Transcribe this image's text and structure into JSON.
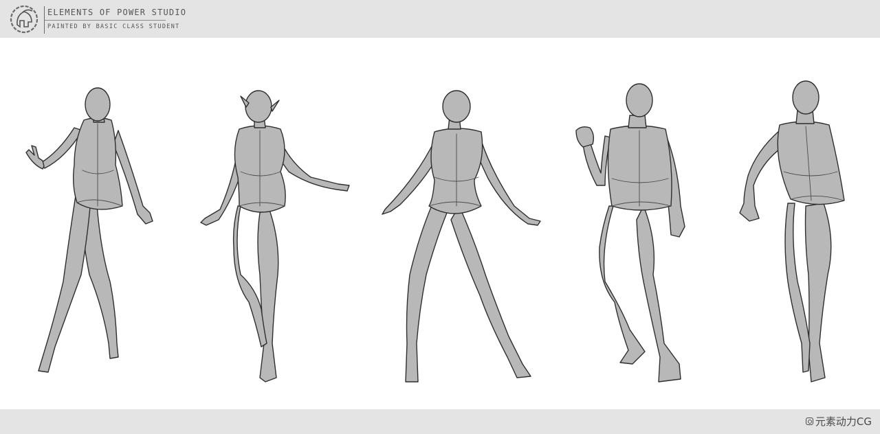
{
  "header": {
    "title": "ELEMENTS OF POWER STUDIO",
    "subtitle": "PAINTED BY BASIC CLASS STUDENT",
    "logo_icon": "spartan-helmet-icon"
  },
  "footer": {
    "watermark": "元素动力CG",
    "watermark_icon": "weibo-camera-icon"
  },
  "colors": {
    "band": "#e4e4e4",
    "canvas": "#ffffff",
    "figure_fill": "#b8b8b8",
    "line": "#2e2e2e"
  },
  "figures": [
    {
      "subject": "female standing pose"
    },
    {
      "subject": "elf female pose"
    },
    {
      "subject": "female wide stance pose"
    },
    {
      "subject": "male raised fist pose"
    },
    {
      "subject": "male walking pose"
    }
  ]
}
